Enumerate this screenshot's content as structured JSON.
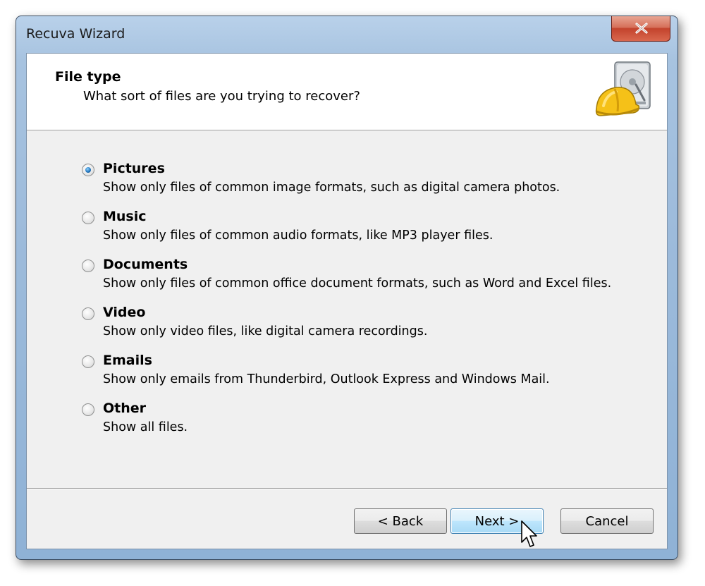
{
  "window": {
    "title": "Recuva Wizard"
  },
  "header": {
    "title": "File type",
    "subtitle": "What sort of files are you trying to recover?"
  },
  "options": [
    {
      "label": "Pictures",
      "description": "Show only files of common image formats, such as digital camera photos.",
      "checked": true
    },
    {
      "label": "Music",
      "description": "Show only files of common audio formats, like MP3 player files.",
      "checked": false
    },
    {
      "label": "Documents",
      "description": "Show only files of common office document formats, such as Word and Excel files.",
      "checked": false
    },
    {
      "label": "Video",
      "description": "Show only video files, like digital camera recordings.",
      "checked": false
    },
    {
      "label": "Emails",
      "description": "Show only emails from Thunderbird, Outlook Express and Windows Mail.",
      "checked": false
    },
    {
      "label": "Other",
      "description": "Show all files.",
      "checked": false
    }
  ],
  "buttons": {
    "back": "< Back",
    "next": "Next >",
    "cancel": "Cancel"
  },
  "icons": {
    "close": "close-icon",
    "logo": "recuva-logo-icon",
    "cursor": "mouse-cursor-icon"
  },
  "colors": {
    "frame": "#9dbbdb",
    "close_button": "#c3432c",
    "default_button": "#bee6fd",
    "radio_selected": "#1c6fb8"
  }
}
